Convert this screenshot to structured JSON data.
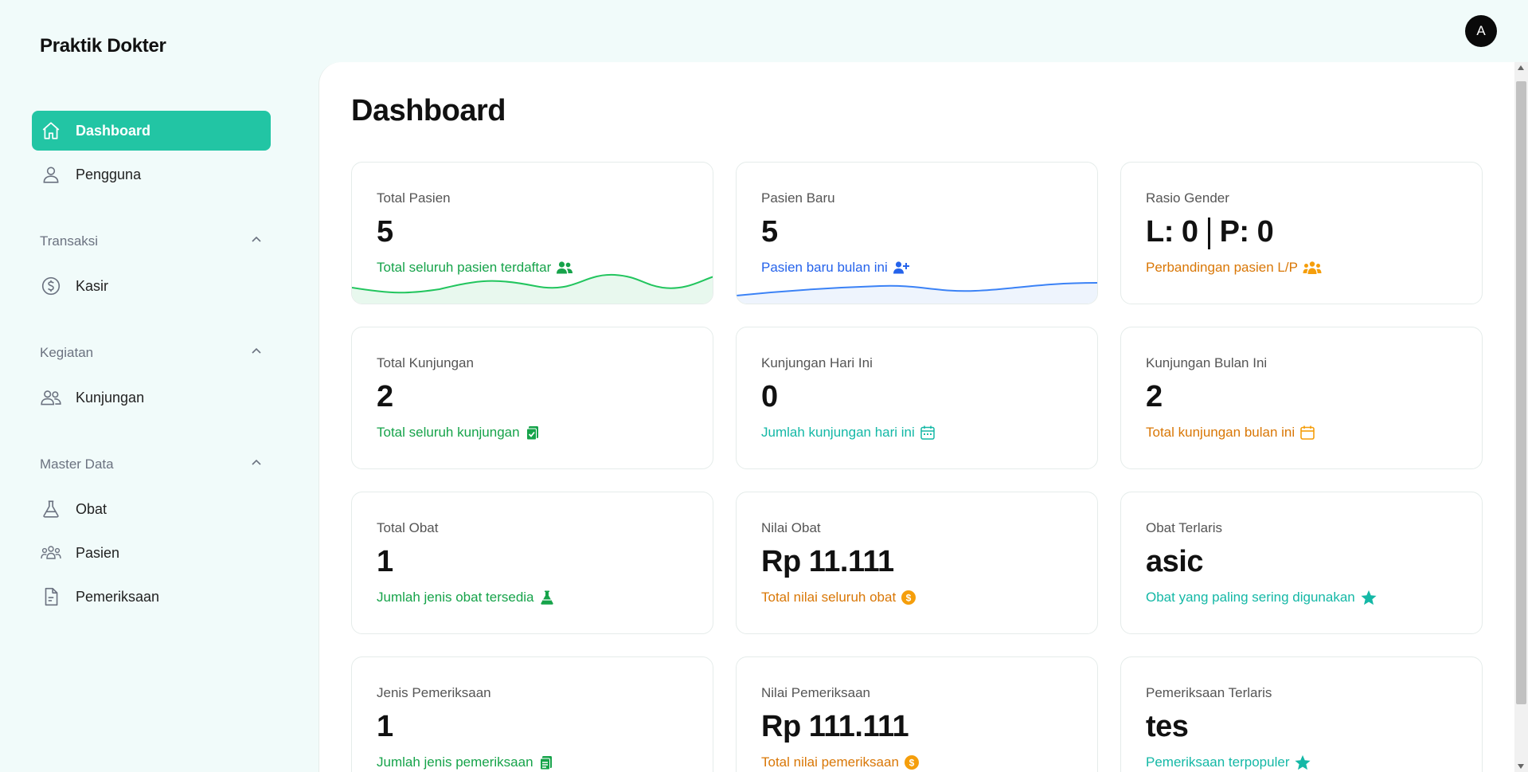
{
  "brand": "Praktik Dokter",
  "user": {
    "avatar_initial": "A"
  },
  "sidebar": {
    "dashboard": "Dashboard",
    "pengguna": "Pengguna",
    "sections": [
      {
        "title": "Transaksi",
        "items": [
          "Kasir"
        ]
      },
      {
        "title": "Kegiatan",
        "items": [
          "Kunjungan"
        ]
      },
      {
        "title": "Master Data",
        "items": [
          "Obat",
          "Pasien",
          "Pemeriksaan"
        ]
      }
    ]
  },
  "main": {
    "title": "Dashboard"
  },
  "cards": [
    {
      "label": "Total Pasien",
      "value": "5",
      "sub": "Total seluruh pasien terdaftar",
      "icon": "users-icon",
      "color": "#16a34a"
    },
    {
      "label": "Pasien Baru",
      "value": "5",
      "sub": "Pasien baru bulan ini",
      "icon": "user-plus-icon",
      "color": "#2563eb"
    },
    {
      "label": "Rasio Gender",
      "value_l": "L: 0",
      "value_p": "P: 0",
      "sub": "Perbandingan pasien L/P",
      "icon": "users-group-icon",
      "color": "#d97706"
    },
    {
      "label": "Total Kunjungan",
      "value": "2",
      "sub": "Total seluruh kunjungan",
      "icon": "clipboard-check-icon",
      "color": "#16a34a"
    },
    {
      "label": "Kunjungan Hari Ini",
      "value": "0",
      "sub": "Jumlah kunjungan hari ini",
      "icon": "calendar-day-icon",
      "color": "#14b8a6"
    },
    {
      "label": "Kunjungan Bulan Ini",
      "value": "2",
      "sub": "Total kunjungan bulan ini",
      "icon": "calendar-icon",
      "color": "#d97706"
    },
    {
      "label": "Total Obat",
      "value": "1",
      "sub": "Jumlah jenis obat tersedia",
      "icon": "flask-icon",
      "color": "#16a34a"
    },
    {
      "label": "Nilai Obat",
      "value": "Rp 11.111",
      "sub": "Total nilai seluruh obat",
      "icon": "coin-icon",
      "color": "#d97706"
    },
    {
      "label": "Obat Terlaris",
      "value": "asic",
      "sub": "Obat yang paling sering digunakan",
      "icon": "star-icon",
      "color": "#14b8a6"
    },
    {
      "label": "Jenis Pemeriksaan",
      "value": "1",
      "sub": "Jumlah jenis pemeriksaan",
      "icon": "clipboard-icon",
      "color": "#16a34a"
    },
    {
      "label": "Nilai Pemeriksaan",
      "value": "Rp 111.111",
      "sub": "Total nilai pemeriksaan",
      "icon": "coin-icon",
      "color": "#d97706"
    },
    {
      "label": "Pemeriksaan Terlaris",
      "value": "tes",
      "sub": "Pemeriksaan terpopuler",
      "icon": "star-icon",
      "color": "#14b8a6"
    }
  ]
}
